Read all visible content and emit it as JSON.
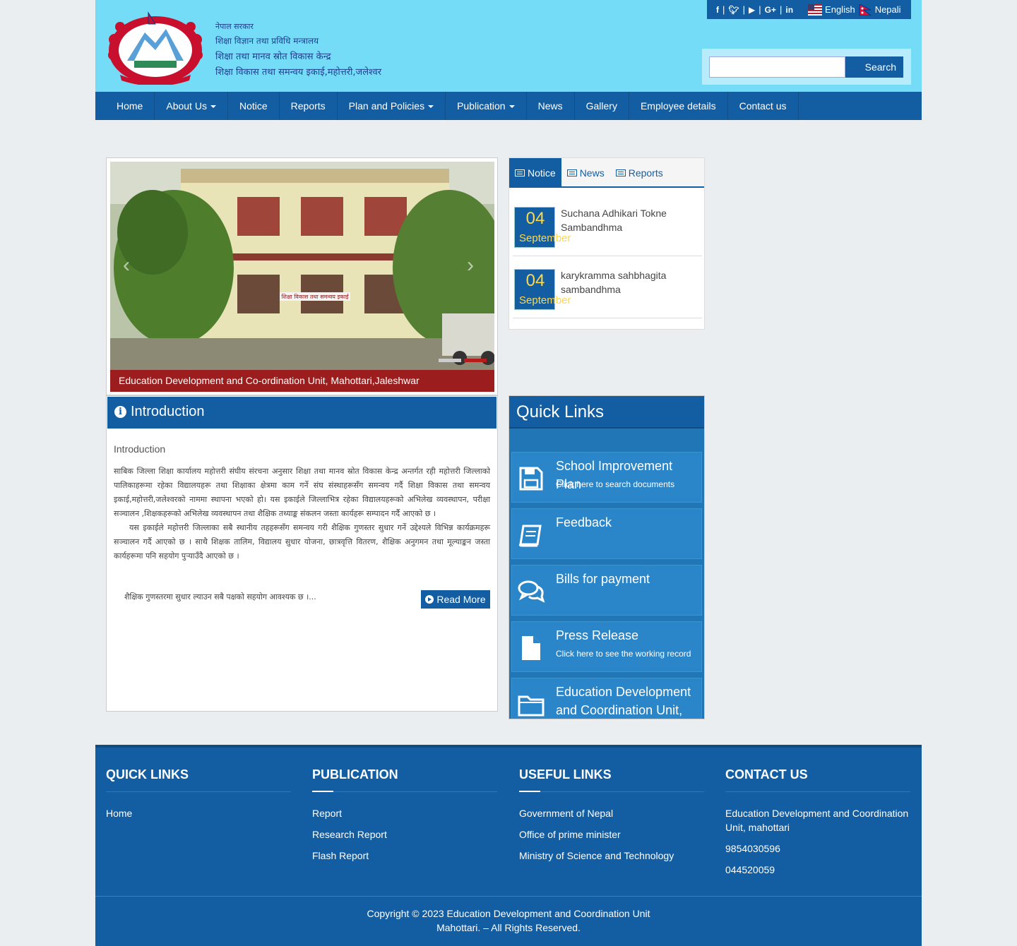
{
  "header": {
    "line1": "नेपाल सरकार",
    "line2": "शिक्षा विज्ञान तथा प्रविधि मन्त्रालय",
    "line3": "शिक्षा तथा मानव स्रोत विकास केन्द्र",
    "line4": "शिक्षा विकास तथा समन्वय इकाई,महोत्तरी,जलेश्वर"
  },
  "social": {
    "icons": [
      "facebook-icon",
      "twitter-icon",
      "youtube-icon",
      "google-plus-icon",
      "linkedin-icon"
    ],
    "lang_en": "English",
    "lang_np": "Nepali"
  },
  "search": {
    "button": "Search",
    "value": ""
  },
  "nav": {
    "items": [
      {
        "label": "Home",
        "dropdown": false
      },
      {
        "label": "About Us",
        "dropdown": true
      },
      {
        "label": "Notice",
        "dropdown": false
      },
      {
        "label": "Reports",
        "dropdown": false
      },
      {
        "label": "Plan and Policies",
        "dropdown": true
      },
      {
        "label": "Publication",
        "dropdown": true
      },
      {
        "label": "News",
        "dropdown": false
      },
      {
        "label": "Gallery",
        "dropdown": false
      },
      {
        "label": "Employee details",
        "dropdown": false
      },
      {
        "label": "Contact us",
        "dropdown": false
      }
    ]
  },
  "slider": {
    "caption": "Education Development and Co-ordination Unit, Mahottari,Jaleshwar",
    "sign_text": "शिक्षा विकास तथा समन्वय इकाई"
  },
  "notice_tabs": {
    "tabs": [
      "Notice",
      "News",
      "Reports"
    ],
    "items": [
      {
        "day": "04",
        "month": "September",
        "title": "Suchana Adhikari Tokne Sambandhma"
      },
      {
        "day": "04",
        "month": "September",
        "title": "karykramma sahbhagita sambandhma"
      }
    ]
  },
  "intro": {
    "heading": "Introduction",
    "subheading": "Introduction",
    "para1": "साबिक जिल्ला शिक्षा कार्यालय महोत्तरी संघीय संरचना अनुसार शिक्षा तथा मानव स्रोत विकास केन्द्र अन्तर्गत रही महोत्तरी जिल्लाको पालिकाहरूमा रहेका विद्यालयहरू तथा शिक्षाका क्षेत्रमा काम गर्ने संघ संस्थाहरूसँग समन्वय गर्दै शिक्षा विकास तथा समन्वय इकाई,महोत्तरी,जलेश्वरको नाममा स्थापना भएको हो। यस इकाईले जिल्लाभित्र रहेका विद्यालयहरूको अभिलेख व्यवस्थापन, परीक्षा सञ्चालन ,शिक्षकहरूको अभिलेख व्यवस्थापन तथा शैक्षिक तथ्याङ्क संकलन जस्ता कार्यहरू सम्पादन गर्दै आएको छ ।",
    "para2": "यस इकाईले महोत्तरी जिल्लाका सबै स्थानीय तहहरूसँग समन्वय गरी शैक्षिक गुणस्तर सुधार गर्ने उद्देश्यले विभिन्न कार्यक्रमहरू सञ्चालन गर्दै आएको छ । साथै शिक्षक तालिम, विद्यालय सुधार योजना, छात्रवृत्ति वितरण, शैक्षिक अनुगमन तथा मूल्याङ्कन जस्ता कार्यहरूमा पनि सहयोग पुर्‍याउँदै आएको छ ।",
    "tail": "शैक्षिक गुणस्तरमा सुधार ल्याउन सबै पक्षको सहयोग आवश्यक छ ।...",
    "read_more": "Read More"
  },
  "quick_links": {
    "heading": "Quick Links",
    "items": [
      {
        "title": "School Improvement Plan",
        "subtitle": "Click here to search documents",
        "icon": "floppy-disk-icon"
      },
      {
        "title": "Feedback",
        "subtitle": "",
        "icon": "book-icon"
      },
      {
        "title": "Bills for payment",
        "subtitle": "",
        "icon": "chat-bubbles-icon"
      },
      {
        "title": "Press Release",
        "subtitle": "Click here to see the working record",
        "icon": "document-icon"
      },
      {
        "title": "Education Development and Coordination Unit, Kathmandu",
        "subtitle": "",
        "icon": "folder-icon"
      }
    ]
  },
  "footer": {
    "quick_links": {
      "heading": "QUICK LINKS",
      "items": [
        "Home"
      ]
    },
    "publication": {
      "heading": "PUBLICATION",
      "items": [
        "Report",
        "Research Report",
        "Flash Report"
      ]
    },
    "useful_links": {
      "heading": "USEFUL LINKS",
      "items": [
        "Government of Nepal",
        "Office of prime minister",
        "Ministry of Science and Technology"
      ]
    },
    "contact": {
      "heading": "CONTACT US",
      "address": " Education Development and Coordination Unit, mahottari",
      "phone1": "9854030596",
      "phone2": "044520059"
    },
    "copyright_line1": "Copyright © 2023 Education Development and Coordination Unit",
    "copyright_line2": "Mahottari. – All Rights Reserved."
  },
  "colors": {
    "primary": "#135ea2",
    "header_bg": "#74dcf7",
    "accent_red": "#9b1d1d",
    "date_text": "#ffd84a"
  }
}
